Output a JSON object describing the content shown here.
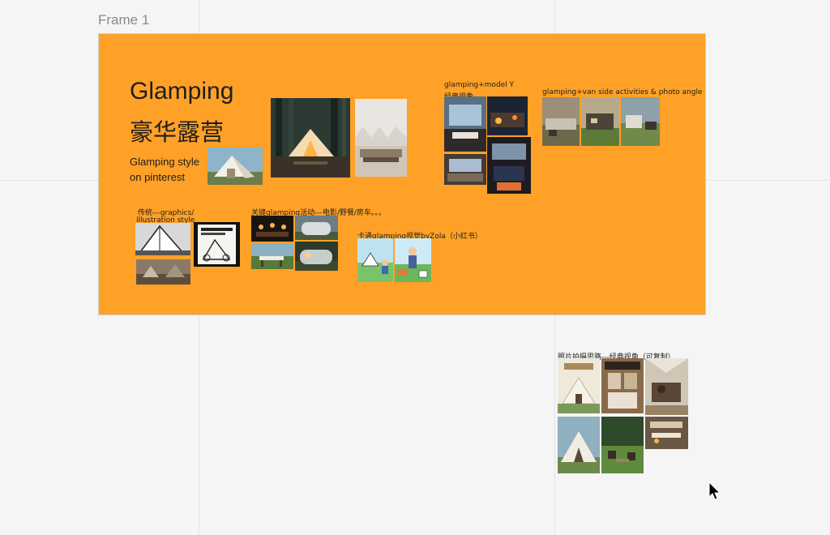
{
  "canvas": {
    "frame_label": "Frame 1"
  },
  "board": {
    "title_en": "Glamping",
    "title_cn": "豪华露营",
    "subtitle_line1": "Glamping style",
    "subtitle_line2": "on pinterest",
    "sections": {
      "model_y": "glamping+model Y",
      "model_y_sub": "经典视角",
      "van": "glamping+van side activities & photo angle",
      "traditional_line1": "传统---graphics/",
      "traditional_line2": "illustration style",
      "activities": "关键glamping活动---电影/野餐/房车。。。",
      "cartoon": "卡通glamping视觉byZola（小红书）"
    }
  },
  "outside": {
    "photo_section": "照片拍摄思路---经典视角（可复制）"
  },
  "colors": {
    "frame_bg": "#ffa126",
    "canvas_bg": "#f5f5f5"
  }
}
